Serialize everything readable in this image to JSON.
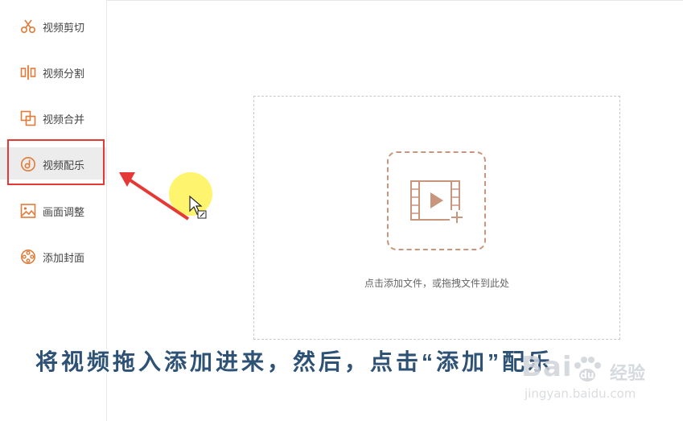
{
  "sidebar": {
    "items": [
      {
        "label": "视频剪切",
        "icon": "scissors-icon"
      },
      {
        "label": "视频分割",
        "icon": "split-icon"
      },
      {
        "label": "视频合并",
        "icon": "merge-icon"
      },
      {
        "label": "视频配乐",
        "icon": "music-note-icon"
      },
      {
        "label": "画面调整",
        "icon": "image-icon"
      },
      {
        "label": "添加封面",
        "icon": "film-reel-icon"
      }
    ],
    "active_index": 3
  },
  "dropzone": {
    "hint": "点击添加文件，或拖拽文件到此处",
    "icon": "add-video-icon"
  },
  "caption": "将视频拖入添加进来，然后，点击“添加”配乐",
  "watermark": {
    "brand": "Bai",
    "brand_cn": "经验",
    "site": "jingyan.baidu.com"
  },
  "colors": {
    "accent": "#e07b39",
    "highlight": "#e53935",
    "caption": "#2e5276",
    "dropzone_icon": "#c8967c"
  }
}
